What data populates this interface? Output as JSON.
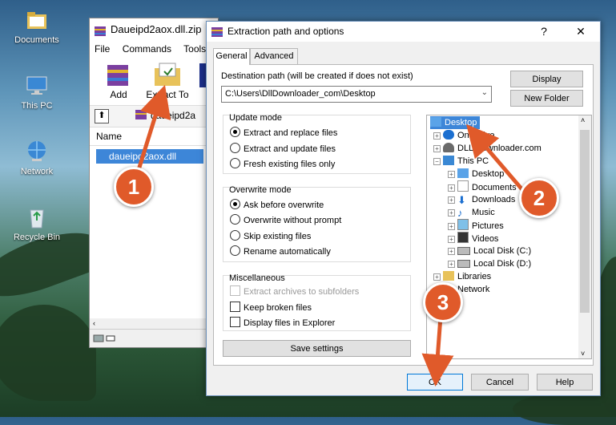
{
  "desktop": {
    "icons": [
      {
        "label": "Documents"
      },
      {
        "label": "This PC"
      },
      {
        "label": "Network"
      },
      {
        "label": "Recycle Bin"
      }
    ]
  },
  "winrar": {
    "title": "Daueipd2aox.dll.zip",
    "menu": [
      "File",
      "Commands",
      "Tools"
    ],
    "toolbar": {
      "add": "Add",
      "extract_to": "Extract To"
    },
    "address": "daueipd2a",
    "list_header": "Name",
    "selected_file": "daueipd2aox.dll"
  },
  "dialog": {
    "title": "Extraction path and options",
    "help_glyph": "?",
    "close_glyph": "✕",
    "tabs": [
      "General",
      "Advanced"
    ],
    "destination_label": "Destination path (will be created if does not exist)",
    "destination_value": "C:\\Users\\DllDownloader_com\\Desktop",
    "display_button": "Display",
    "new_folder_button": "New Folder",
    "update_mode": {
      "label": "Update mode",
      "options": [
        "Extract and replace files",
        "Extract and update files",
        "Fresh existing files only"
      ],
      "selected": 0
    },
    "overwrite_mode": {
      "label": "Overwrite mode",
      "options": [
        "Ask before overwrite",
        "Overwrite without prompt",
        "Skip existing files",
        "Rename automatically"
      ],
      "selected": 0
    },
    "misc": {
      "label": "Miscellaneous",
      "options": [
        "Extract archives to subfolders",
        "Keep broken files",
        "Display files in Explorer"
      ]
    },
    "save_settings": "Save settings",
    "tree": [
      "Desktop",
      "OneDrive",
      "DLL Downloader.com",
      "This PC",
      "Desktop",
      "Documents",
      "Downloads",
      "Music",
      "Pictures",
      "Videos",
      "Local Disk (C:)",
      "Local Disk (D:)",
      "Libraries",
      "Network"
    ],
    "ok": "OK",
    "cancel": "Cancel",
    "help": "Help"
  },
  "annotations": [
    "1",
    "2",
    "3"
  ],
  "colors": {
    "badge": "#e05a2a",
    "selection": "#3d86d8",
    "arrow": "#e05a2a"
  }
}
